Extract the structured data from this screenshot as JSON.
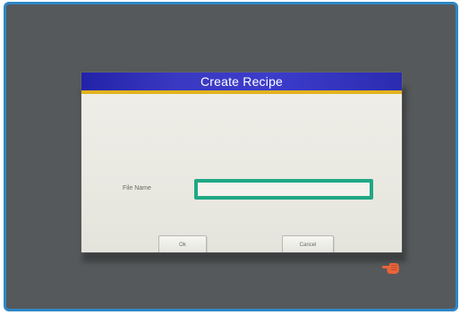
{
  "dialog": {
    "title": "Create Recipe",
    "file_name_label": "File Name",
    "file_name_value": "",
    "ok_label": "Ok",
    "cancel_label": "Cancel"
  },
  "colors": {
    "frame_border": "#2f86c6",
    "screen_background": "#55595b",
    "titlebar": "#3a39c2",
    "title_underline": "#e2b21c",
    "field_highlight": "#1ea884",
    "pointer_hand": "#e8643a"
  },
  "icons": {
    "pointer": "hand-pointer-icon"
  }
}
